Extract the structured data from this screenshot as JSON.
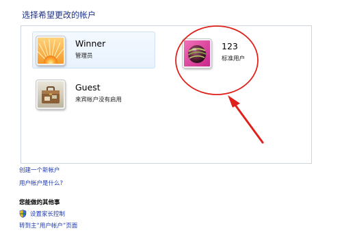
{
  "page_title": "选择希望更改的帐户",
  "accounts": [
    {
      "name": "Winner",
      "role": "管理员",
      "avatar_icon": "flower-avatar-icon",
      "selected": true
    },
    {
      "name": "123",
      "role": "标准用户",
      "avatar_icon": "striped-ball-avatar-icon",
      "selected": false
    },
    {
      "name": "Guest",
      "role": "来宾帐户没有启用",
      "avatar_icon": "suitcase-avatar-icon",
      "selected": false
    }
  ],
  "links": {
    "create_account": "创建一个新帐户",
    "what_is_account": "用户帐户是什么?"
  },
  "other_tasks": {
    "heading": "您能做的其他事",
    "parental_controls": "设置家长控制",
    "goto_user_accounts": "转到主“用户帐户”页面",
    "shield_icon": "security-shield-icon"
  },
  "annotation": {
    "color": "#e0201b",
    "shapes": [
      "red-circle-highlight",
      "red-arrow"
    ]
  },
  "colors": {
    "link": "#1e3ab4",
    "title": "#1e3287",
    "panel_border": "#cdd4df",
    "selected_tile": "#e8f2fe"
  }
}
